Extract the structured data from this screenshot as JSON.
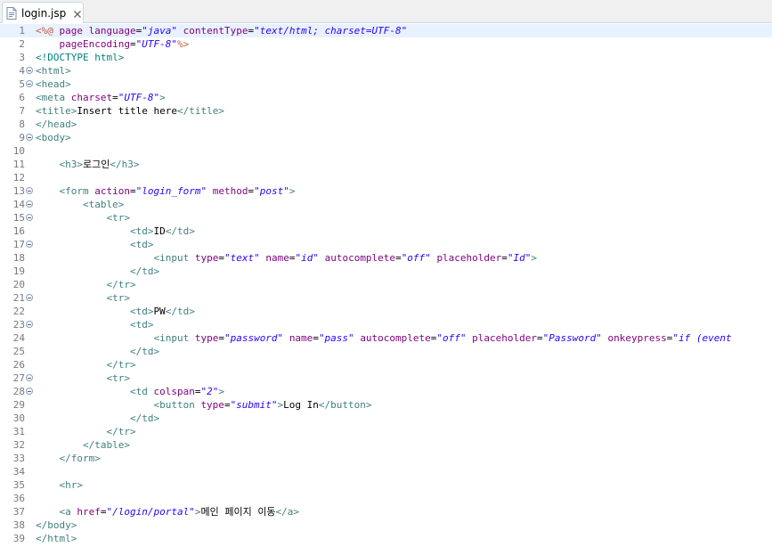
{
  "tab": {
    "title": "login.jsp",
    "icon": "jsp-file-icon",
    "close_icon": "close-icon"
  },
  "colors": {
    "tag": "#3f7f7f",
    "attribute": "#7f007f",
    "value": "#2a00ff",
    "directive": "#bf5f3f",
    "current_line": "#e8f2fe"
  },
  "editor": {
    "lines": [
      {
        "n": "1",
        "fold": false,
        "tokens": [
          {
            "t": "dr",
            "v": "<%@"
          },
          {
            "t": "tx",
            "v": " "
          },
          {
            "t": "at",
            "v": "page"
          },
          {
            "t": "tx",
            "v": " "
          },
          {
            "t": "at",
            "v": "language"
          },
          {
            "t": "tx",
            "v": "="
          },
          {
            "t": "va",
            "v": "\"java\""
          },
          {
            "t": "tx",
            "v": " "
          },
          {
            "t": "at",
            "v": "contentType"
          },
          {
            "t": "tx",
            "v": "="
          },
          {
            "t": "va",
            "v": "\"text/html; charset=UTF-8\""
          }
        ]
      },
      {
        "n": "2",
        "fold": false,
        "tokens": [
          {
            "t": "tx",
            "v": "    "
          },
          {
            "t": "at",
            "v": "pageEncoding"
          },
          {
            "t": "tx",
            "v": "="
          },
          {
            "t": "va",
            "v": "\"UTF-8\""
          },
          {
            "t": "dr",
            "v": "%>"
          }
        ]
      },
      {
        "n": "3",
        "fold": false,
        "tokens": [
          {
            "t": "dt",
            "v": "<!DOCTYPE html>"
          }
        ]
      },
      {
        "n": "4",
        "fold": true,
        "tokens": [
          {
            "t": "tg",
            "v": "<html>"
          }
        ]
      },
      {
        "n": "5",
        "fold": true,
        "tokens": [
          {
            "t": "tg",
            "v": "<head>"
          }
        ]
      },
      {
        "n": "6",
        "fold": false,
        "tokens": [
          {
            "t": "tg",
            "v": "<meta"
          },
          {
            "t": "tx",
            "v": " "
          },
          {
            "t": "at",
            "v": "charset"
          },
          {
            "t": "tx",
            "v": "="
          },
          {
            "t": "va",
            "v": "\"UTF-8\""
          },
          {
            "t": "tg",
            "v": ">"
          }
        ]
      },
      {
        "n": "7",
        "fold": false,
        "tokens": [
          {
            "t": "tg",
            "v": "<title>"
          },
          {
            "t": "tx",
            "v": "Insert title here"
          },
          {
            "t": "tg",
            "v": "</title>"
          }
        ]
      },
      {
        "n": "8",
        "fold": false,
        "tokens": [
          {
            "t": "tg",
            "v": "</head>"
          }
        ]
      },
      {
        "n": "9",
        "fold": true,
        "tokens": [
          {
            "t": "tg",
            "v": "<body>"
          }
        ]
      },
      {
        "n": "10",
        "fold": false,
        "tokens": []
      },
      {
        "n": "11",
        "fold": false,
        "tokens": [
          {
            "t": "tx",
            "v": "    "
          },
          {
            "t": "tg",
            "v": "<h3>"
          },
          {
            "t": "tx",
            "v": "로그인"
          },
          {
            "t": "tg",
            "v": "</h3>"
          }
        ]
      },
      {
        "n": "12",
        "fold": false,
        "tokens": []
      },
      {
        "n": "13",
        "fold": true,
        "tokens": [
          {
            "t": "tx",
            "v": "    "
          },
          {
            "t": "tg",
            "v": "<form"
          },
          {
            "t": "tx",
            "v": " "
          },
          {
            "t": "at",
            "v": "action"
          },
          {
            "t": "tx",
            "v": "="
          },
          {
            "t": "va",
            "v": "\"login_form\""
          },
          {
            "t": "tx",
            "v": " "
          },
          {
            "t": "at",
            "v": "method"
          },
          {
            "t": "tx",
            "v": "="
          },
          {
            "t": "va",
            "v": "\"post\""
          },
          {
            "t": "tg",
            "v": ">"
          }
        ]
      },
      {
        "n": "14",
        "fold": true,
        "tokens": [
          {
            "t": "tx",
            "v": "        "
          },
          {
            "t": "tg",
            "v": "<table>"
          }
        ]
      },
      {
        "n": "15",
        "fold": true,
        "tokens": [
          {
            "t": "tx",
            "v": "            "
          },
          {
            "t": "tg",
            "v": "<tr>"
          }
        ]
      },
      {
        "n": "16",
        "fold": false,
        "tokens": [
          {
            "t": "tx",
            "v": "                "
          },
          {
            "t": "tg",
            "v": "<td>"
          },
          {
            "t": "tx",
            "v": "ID"
          },
          {
            "t": "tg",
            "v": "</td>"
          }
        ]
      },
      {
        "n": "17",
        "fold": true,
        "tokens": [
          {
            "t": "tx",
            "v": "                "
          },
          {
            "t": "tg",
            "v": "<td>"
          }
        ]
      },
      {
        "n": "18",
        "fold": false,
        "tokens": [
          {
            "t": "tx",
            "v": "                    "
          },
          {
            "t": "tg",
            "v": "<input"
          },
          {
            "t": "tx",
            "v": " "
          },
          {
            "t": "at",
            "v": "type"
          },
          {
            "t": "tx",
            "v": "="
          },
          {
            "t": "va",
            "v": "\"text\""
          },
          {
            "t": "tx",
            "v": " "
          },
          {
            "t": "at",
            "v": "name"
          },
          {
            "t": "tx",
            "v": "="
          },
          {
            "t": "va",
            "v": "\"id\""
          },
          {
            "t": "tx",
            "v": " "
          },
          {
            "t": "at",
            "v": "autocomplete"
          },
          {
            "t": "tx",
            "v": "="
          },
          {
            "t": "va",
            "v": "\"off\""
          },
          {
            "t": "tx",
            "v": " "
          },
          {
            "t": "at",
            "v": "placeholder"
          },
          {
            "t": "tx",
            "v": "="
          },
          {
            "t": "va",
            "v": "\"Id\""
          },
          {
            "t": "tg",
            "v": ">"
          }
        ]
      },
      {
        "n": "19",
        "fold": false,
        "tokens": [
          {
            "t": "tx",
            "v": "                "
          },
          {
            "t": "tg",
            "v": "</td>"
          }
        ]
      },
      {
        "n": "20",
        "fold": false,
        "tokens": [
          {
            "t": "tx",
            "v": "            "
          },
          {
            "t": "tg",
            "v": "</tr>"
          }
        ]
      },
      {
        "n": "21",
        "fold": true,
        "tokens": [
          {
            "t": "tx",
            "v": "            "
          },
          {
            "t": "tg",
            "v": "<tr>"
          }
        ]
      },
      {
        "n": "22",
        "fold": false,
        "tokens": [
          {
            "t": "tx",
            "v": "                "
          },
          {
            "t": "tg",
            "v": "<td>"
          },
          {
            "t": "tx",
            "v": "PW"
          },
          {
            "t": "tg",
            "v": "</td>"
          }
        ]
      },
      {
        "n": "23",
        "fold": true,
        "tokens": [
          {
            "t": "tx",
            "v": "                "
          },
          {
            "t": "tg",
            "v": "<td>"
          }
        ]
      },
      {
        "n": "24",
        "fold": false,
        "tokens": [
          {
            "t": "tx",
            "v": "                    "
          },
          {
            "t": "tg",
            "v": "<input"
          },
          {
            "t": "tx",
            "v": " "
          },
          {
            "t": "at",
            "v": "type"
          },
          {
            "t": "tx",
            "v": "="
          },
          {
            "t": "va",
            "v": "\"password\""
          },
          {
            "t": "tx",
            "v": " "
          },
          {
            "t": "at",
            "v": "name"
          },
          {
            "t": "tx",
            "v": "="
          },
          {
            "t": "va",
            "v": "\"pass\""
          },
          {
            "t": "tx",
            "v": " "
          },
          {
            "t": "at",
            "v": "autocomplete"
          },
          {
            "t": "tx",
            "v": "="
          },
          {
            "t": "va",
            "v": "\"off\""
          },
          {
            "t": "tx",
            "v": " "
          },
          {
            "t": "at",
            "v": "placeholder"
          },
          {
            "t": "tx",
            "v": "="
          },
          {
            "t": "va",
            "v": "\"Password\""
          },
          {
            "t": "tx",
            "v": " "
          },
          {
            "t": "at",
            "v": "onkeypress"
          },
          {
            "t": "tx",
            "v": "="
          },
          {
            "t": "va",
            "v": "\"if (event"
          }
        ]
      },
      {
        "n": "25",
        "fold": false,
        "tokens": [
          {
            "t": "tx",
            "v": "                "
          },
          {
            "t": "tg",
            "v": "</td>"
          }
        ]
      },
      {
        "n": "26",
        "fold": false,
        "tokens": [
          {
            "t": "tx",
            "v": "            "
          },
          {
            "t": "tg",
            "v": "</tr>"
          }
        ]
      },
      {
        "n": "27",
        "fold": true,
        "tokens": [
          {
            "t": "tx",
            "v": "            "
          },
          {
            "t": "tg",
            "v": "<tr>"
          }
        ]
      },
      {
        "n": "28",
        "fold": true,
        "tokens": [
          {
            "t": "tx",
            "v": "                "
          },
          {
            "t": "tg",
            "v": "<td"
          },
          {
            "t": "tx",
            "v": " "
          },
          {
            "t": "at",
            "v": "colspan"
          },
          {
            "t": "tx",
            "v": "="
          },
          {
            "t": "va",
            "v": "\"2\""
          },
          {
            "t": "tg",
            "v": ">"
          }
        ]
      },
      {
        "n": "29",
        "fold": false,
        "tokens": [
          {
            "t": "tx",
            "v": "                    "
          },
          {
            "t": "tg",
            "v": "<button"
          },
          {
            "t": "tx",
            "v": " "
          },
          {
            "t": "at",
            "v": "type"
          },
          {
            "t": "tx",
            "v": "="
          },
          {
            "t": "va",
            "v": "\"submit\""
          },
          {
            "t": "tg",
            "v": ">"
          },
          {
            "t": "tx",
            "v": "Log In"
          },
          {
            "t": "tg",
            "v": "</button>"
          }
        ]
      },
      {
        "n": "30",
        "fold": false,
        "tokens": [
          {
            "t": "tx",
            "v": "                "
          },
          {
            "t": "tg",
            "v": "</td>"
          }
        ]
      },
      {
        "n": "31",
        "fold": false,
        "tokens": [
          {
            "t": "tx",
            "v": "            "
          },
          {
            "t": "tg",
            "v": "</tr>"
          }
        ]
      },
      {
        "n": "32",
        "fold": false,
        "tokens": [
          {
            "t": "tx",
            "v": "        "
          },
          {
            "t": "tg",
            "v": "</table>"
          }
        ]
      },
      {
        "n": "33",
        "fold": false,
        "tokens": [
          {
            "t": "tx",
            "v": "    "
          },
          {
            "t": "tg",
            "v": "</form>"
          }
        ]
      },
      {
        "n": "34",
        "fold": false,
        "tokens": []
      },
      {
        "n": "35",
        "fold": false,
        "tokens": [
          {
            "t": "tx",
            "v": "    "
          },
          {
            "t": "tg",
            "v": "<hr>"
          }
        ]
      },
      {
        "n": "36",
        "fold": false,
        "tokens": []
      },
      {
        "n": "37",
        "fold": false,
        "tokens": [
          {
            "t": "tx",
            "v": "    "
          },
          {
            "t": "tg",
            "v": "<a"
          },
          {
            "t": "tx",
            "v": " "
          },
          {
            "t": "at",
            "v": "href"
          },
          {
            "t": "tx",
            "v": "="
          },
          {
            "t": "va",
            "v": "\"/login/portal\""
          },
          {
            "t": "tg",
            "v": ">"
          },
          {
            "t": "tx",
            "v": "메인 페이지 이동"
          },
          {
            "t": "tg",
            "v": "</a>"
          }
        ]
      },
      {
        "n": "38",
        "fold": false,
        "tokens": [
          {
            "t": "tg",
            "v": "</body>"
          }
        ]
      },
      {
        "n": "39",
        "fold": false,
        "tokens": [
          {
            "t": "tg",
            "v": "</html>"
          }
        ]
      }
    ]
  }
}
